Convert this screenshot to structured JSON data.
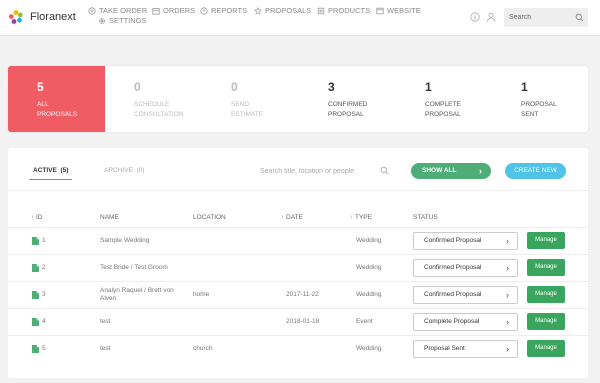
{
  "header": {
    "brand": "Floranext",
    "nav": [
      {
        "label": "TAKE ORDER",
        "icon": "plus-circle-icon"
      },
      {
        "label": "ORDERS",
        "icon": "box-icon"
      },
      {
        "label": "REPORTS",
        "icon": "clock-icon"
      },
      {
        "label": "PROPOSALS",
        "icon": "star-icon"
      },
      {
        "label": "PRODUCTS",
        "icon": "product-icon"
      },
      {
        "label": "WEBSITE",
        "icon": "window-icon"
      },
      {
        "label": "SETTINGS",
        "icon": "gear-icon"
      }
    ],
    "search_placeholder": "Search"
  },
  "stats": [
    {
      "value": "5",
      "label1": "ALL",
      "label2": "PROPOSALS"
    },
    {
      "value": "0",
      "label1": "SCHEDULE",
      "label2": "CONSULTATION"
    },
    {
      "value": "0",
      "label1": "SEND",
      "label2": "ESTIMATE"
    },
    {
      "value": "3",
      "label1": "CONFIRMED",
      "label2": "PROPOSAL"
    },
    {
      "value": "1",
      "label1": "COMPLETE",
      "label2": "PROPOSAL"
    },
    {
      "value": "1",
      "label1": "PROPOSAL",
      "label2": "SENT"
    }
  ],
  "tabs": {
    "active_label": "ACTIVE",
    "active_count": "(5)",
    "archive_label": "ARCHIVE",
    "archive_count": "(0)"
  },
  "filter": {
    "placeholder": "Search title, location or people",
    "show_all": "SHOW ALL",
    "create_new": "CREATE NEW"
  },
  "table": {
    "columns": {
      "id": "ID",
      "name": "NAME",
      "location": "LOCATION",
      "date": "DATE",
      "type": "TYPE",
      "status": "STATUS"
    },
    "manage_label": "Manage",
    "rows": [
      {
        "id": "1",
        "name": "Sample Wedding",
        "name2": "",
        "location": "",
        "date": "",
        "type": "Wedding",
        "status": "Confirmed Proposal"
      },
      {
        "id": "2",
        "name": "Test Bride / Test Groom",
        "name2": "",
        "location": "",
        "date": "",
        "type": "Wedding",
        "status": "Confirmed Proposal"
      },
      {
        "id": "3",
        "name": "Analyn Raquel / Brett von",
        "name2": "Alven",
        "location": "home",
        "date": "2017-11-22",
        "type": "Wedding",
        "status": "Confirmed Proposal"
      },
      {
        "id": "4",
        "name": "test",
        "name2": "",
        "location": "",
        "date": "2018-01-18",
        "type": "Event",
        "status": "Complete Proposal"
      },
      {
        "id": "5",
        "name": "test",
        "name2": "",
        "location": "church",
        "date": "",
        "type": "Wedding",
        "status": "Proposal Sent"
      }
    ]
  },
  "colors": {
    "accent_red": "#ef5c64",
    "green": "#4fae78",
    "manage_green": "#3aa55f",
    "blue": "#4fc3e8"
  }
}
